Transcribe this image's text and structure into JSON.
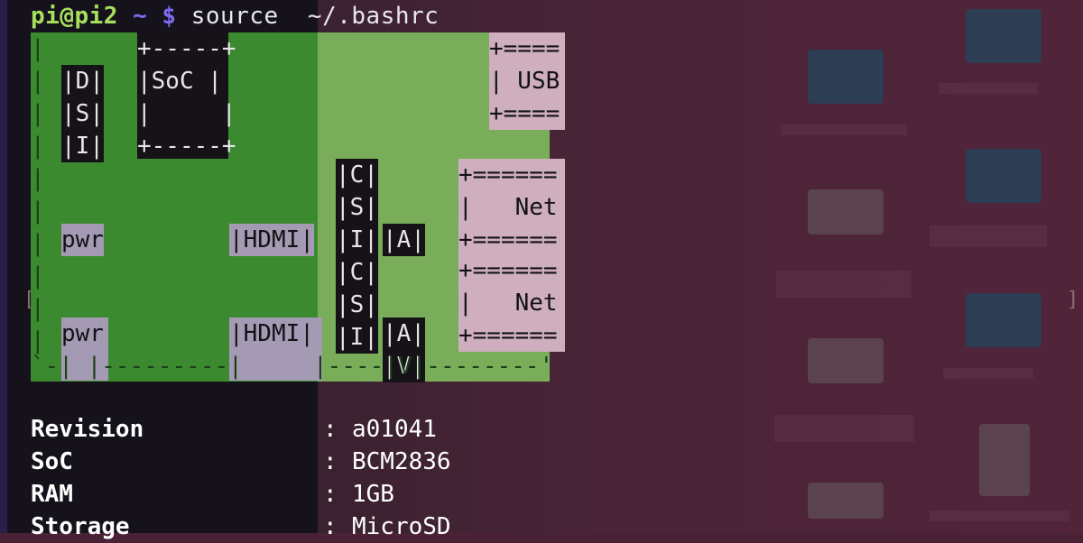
{
  "prompt": {
    "user_host": "pi@pi2",
    "dir": "~",
    "symbol": "$",
    "command": "source  ~/.bashrc"
  },
  "board": {
    "dsi": [
      "|D|",
      "|S|",
      "|I|"
    ],
    "soc": [
      "+-----+",
      "|SoC |",
      "|     |",
      "+-----+"
    ],
    "usb": [
      "+====",
      "| USB",
      "+===="
    ],
    "net1": [
      "+======",
      "|   Net",
      "+======"
    ],
    "net2": [
      "+======",
      "|   Net",
      "+======"
    ],
    "csi": [
      "|C|",
      "|S|",
      "|I|",
      "|C|",
      "|S|",
      "|I|"
    ],
    "av1": "|A|",
    "av2": [
      "|A|",
      "|V|"
    ],
    "pwr1": "pwr",
    "pwr2": "pwr",
    "hdmi1": "|HDMI|",
    "hdmi2": "|HDMI|",
    "bottom_edge": "`-| |---------|     |----|V|--------'"
  },
  "info": [
    {
      "key": "Revision",
      "value": "a01041"
    },
    {
      "key": "SoC",
      "value": "BCM2836"
    },
    {
      "key": "RAM",
      "value": "1GB"
    },
    {
      "key": "Storage",
      "value": "MicroSD"
    }
  ],
  "colors": {
    "board_green": "#3b8a2f",
    "prompt_green": "#a6e05d",
    "prompt_purple": "#7d6cf0",
    "pink": "#cfaebd"
  }
}
